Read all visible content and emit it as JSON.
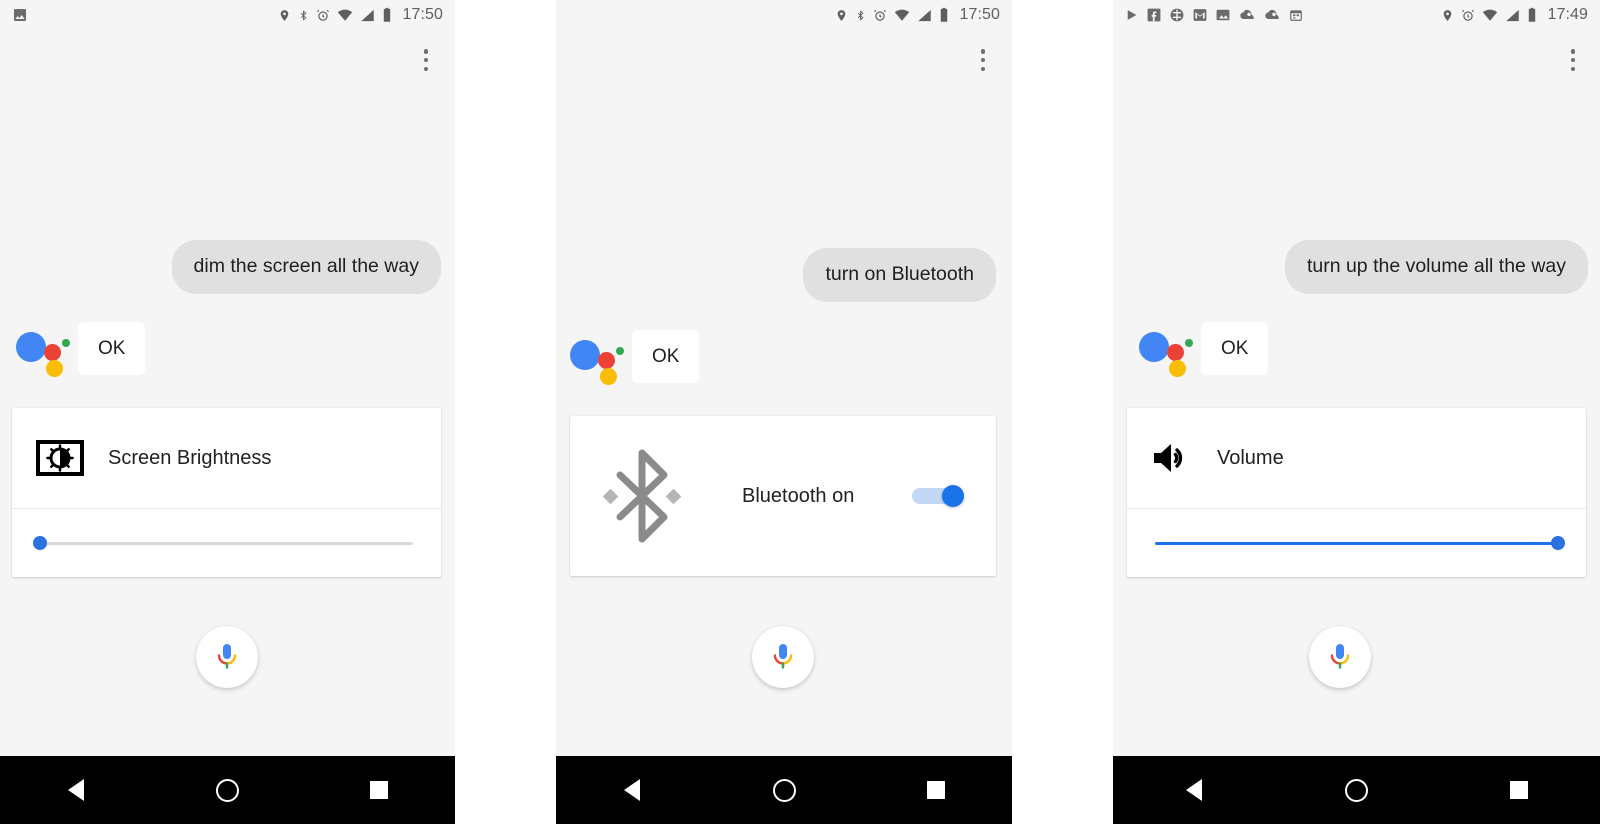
{
  "app": {
    "name": "Google Assistant",
    "accent_blue": "#4285f4",
    "accent_red": "#ea4335",
    "accent_yellow": "#fbbc05",
    "accent_green": "#34a853",
    "slider_blue": "#1a73e8",
    "bubble_gray": "#e0e0e0",
    "panel_bg": "#f5f5f5"
  },
  "panels": [
    {
      "id": "brightness",
      "status_bar": {
        "time": "17:50",
        "left_icons": [
          "image-icon"
        ],
        "right_icons": [
          "location-icon",
          "bluetooth-icon",
          "alarm-icon",
          "wifi-icon",
          "signal-icon",
          "battery-icon"
        ]
      },
      "overflow_label": "More options",
      "user_query": "dim the screen all the way",
      "assistant_reply": "OK",
      "card": {
        "icon": "brightness-icon",
        "title": "Screen Brightness",
        "control": "slider",
        "slider_value": 0,
        "slider_min": 0,
        "slider_max": 100
      },
      "mic_label": "Microphone",
      "nav": [
        "back-button",
        "home-button",
        "recents-button"
      ]
    },
    {
      "id": "bluetooth",
      "status_bar": {
        "time": "17:50",
        "left_icons": [],
        "right_icons": [
          "location-icon",
          "bluetooth-icon",
          "alarm-icon",
          "wifi-icon",
          "signal-icon",
          "battery-icon"
        ]
      },
      "overflow_label": "More options",
      "user_query": "turn on Bluetooth",
      "assistant_reply": "OK",
      "card": {
        "icon": "bluetooth-icon",
        "title": "Bluetooth on",
        "control": "toggle",
        "toggle_on": true
      },
      "mic_label": "Microphone",
      "nav": [
        "back-button",
        "home-button",
        "recents-button"
      ]
    },
    {
      "id": "volume",
      "status_bar": {
        "time": "17:49",
        "left_icons": [
          "play-icon",
          "facebook-icon",
          "app-icon",
          "gmail-icon",
          "photos-icon",
          "cloud-icon",
          "cloud-icon",
          "calendar-icon"
        ],
        "right_icons": [
          "location-icon",
          "alarm-icon",
          "wifi-icon",
          "signal-icon",
          "battery-icon"
        ]
      },
      "overflow_label": "More options",
      "user_query": "turn up the volume all the way",
      "assistant_reply": "OK",
      "card": {
        "icon": "volume-icon",
        "title": "Volume",
        "control": "slider",
        "slider_value": 100,
        "slider_min": 0,
        "slider_max": 100
      },
      "mic_label": "Microphone",
      "nav": [
        "back-button",
        "home-button",
        "recents-button"
      ]
    }
  ]
}
